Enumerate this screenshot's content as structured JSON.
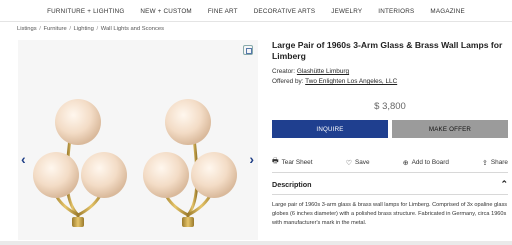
{
  "nav": {
    "items": [
      "FURNITURE + LIGHTING",
      "NEW + CUSTOM",
      "FINE ART",
      "DECORATIVE ARTS",
      "JEWELRY",
      "INTERIORS",
      "MAGAZINE"
    ]
  },
  "breadcrumb": [
    "Listings",
    "Furniture",
    "Lighting",
    "Wall Lights and Sconces"
  ],
  "gallery": {
    "expand_icon": "expand-icon",
    "prev_glyph": "‹",
    "next_glyph": "›"
  },
  "product": {
    "title": "Large Pair of 1960s 3-Arm Glass & Brass Wall Lamps for Limberg",
    "creator_label": "Creator:",
    "creator": "Glashütte Limburg",
    "offered_label": "Offered by:",
    "offered_by": "Two Enlighten Los Angeles, LLC",
    "price": "$ 3,800",
    "inquire_label": "INQUIRE",
    "offer_label": "MAKE OFFER",
    "actions": {
      "tear_sheet": "Tear Sheet",
      "save": "Save",
      "add_to_board": "Add to Board",
      "share": "Share"
    },
    "description_heading": "Description",
    "description": "Large pair of 1960s 3-arm glass & brass wall lamps for Limberg. Comprised of 3x opaline glass globes (6 inches diameter) with a polished brass structure. Fabricated in Germany, circa 1960s with manufacturer's mark in the metal."
  },
  "colors": {
    "accent": "#1f3f8f",
    "offer_button": "#9b9b9b",
    "brass": "#c9a44a",
    "globe": "#f3dcc6"
  }
}
